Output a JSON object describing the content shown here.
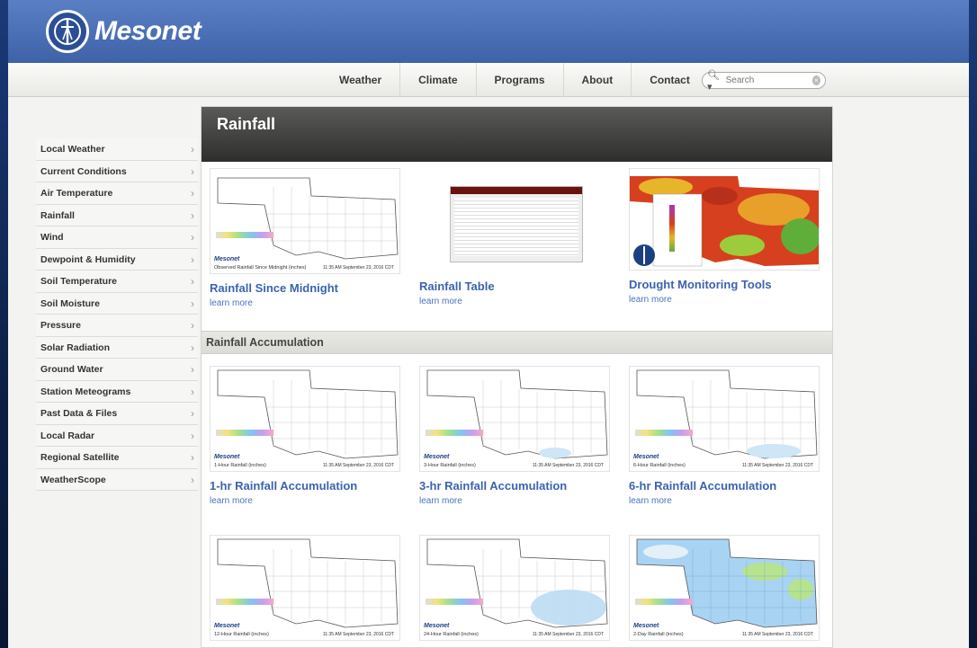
{
  "header": {
    "logo_text": "Mesonet"
  },
  "nav": {
    "items": [
      "Weather",
      "Climate",
      "Programs",
      "About",
      "Contact"
    ],
    "search_placeholder": "Search"
  },
  "sidebar": {
    "items": [
      "Local Weather",
      "Current Conditions",
      "Air Temperature",
      "Rainfall",
      "Wind",
      "Dewpoint & Humidity",
      "Soil Temperature",
      "Soil Moisture",
      "Pressure",
      "Solar Radiation",
      "Ground Water",
      "Station Meteograms",
      "Past Data & Files",
      "Local Radar",
      "Regional Satellite",
      "WeatherScope"
    ]
  },
  "main": {
    "title": "Rainfall",
    "section_title": "Rainfall Accumulation",
    "learn_more": "learn more",
    "top_cards": [
      {
        "title": "Rainfall Since Midnight",
        "caption": "Observed Rainfall Since Midnight (inches)"
      },
      {
        "title": "Rainfall Table"
      },
      {
        "title": "Drought Monitoring Tools"
      }
    ],
    "accum_cards": [
      {
        "title": "1-hr Rainfall Accumulation",
        "caption": "1-Hour Rainfall (inches)"
      },
      {
        "title": "3-hr Rainfall Accumulation",
        "caption": "3-Hour Rainfall (inches)"
      },
      {
        "title": "6-hr Rainfall Accumulation",
        "caption": "6-Hour Rainfall (inches)"
      }
    ],
    "bottom_captions": [
      "12-Hour Rainfall (inches)",
      "24-Hour Rainfall (inches)",
      "2-Day Rainfall (inches)"
    ],
    "map_logo": "Mesonet",
    "map_timestamp": "11:35 AM September 23, 2016 CDT"
  },
  "colors": {
    "header_blue": "#3e62a8",
    "link_blue": "#3b63b0",
    "title_bar": "#2e2e2c"
  }
}
